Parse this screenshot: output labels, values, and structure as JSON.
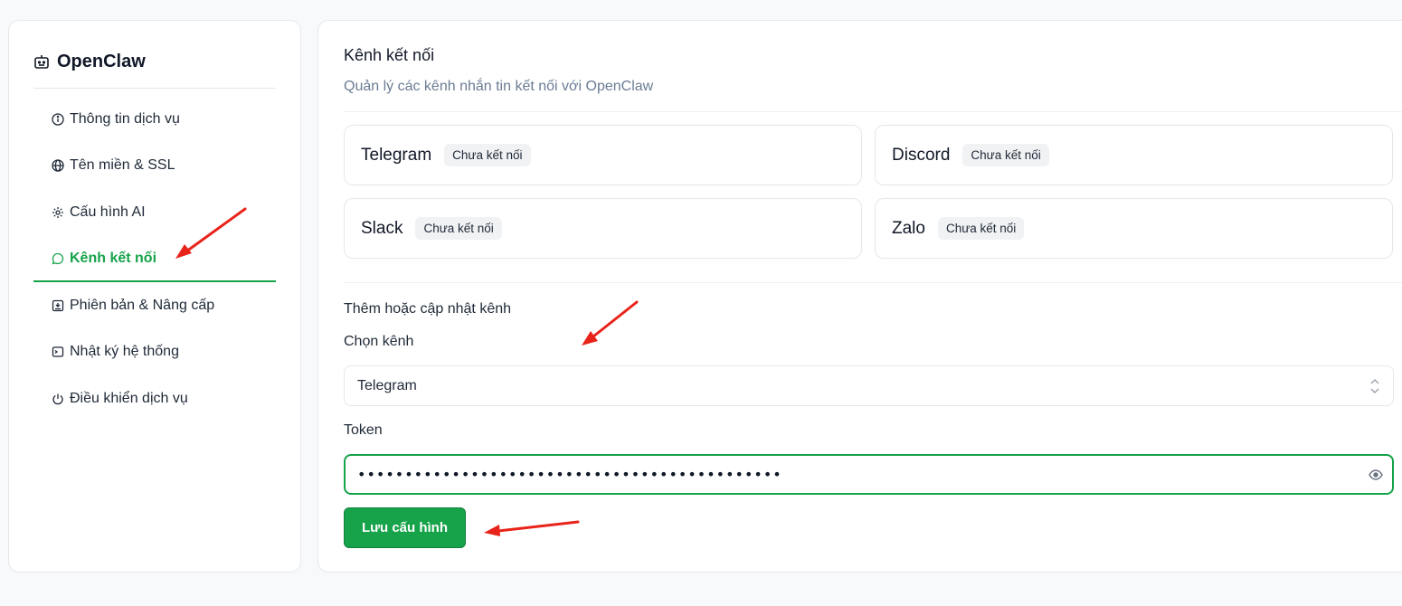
{
  "sidebar": {
    "brand": "OpenClaw",
    "items": [
      {
        "label": "Thông tin dịch vụ",
        "icon": "info-icon"
      },
      {
        "label": "Tên miền & SSL",
        "icon": "globe-icon"
      },
      {
        "label": "Cấu hình AI",
        "icon": "gear-icon"
      },
      {
        "label": "Kênh kết nối",
        "icon": "chat-icon",
        "active": true
      },
      {
        "label": "Phiên bản & Nâng cấp",
        "icon": "package-icon"
      },
      {
        "label": "Nhật ký hệ thống",
        "icon": "terminal-icon"
      },
      {
        "label": "Điều khiển dịch vụ",
        "icon": "power-icon"
      }
    ]
  },
  "main": {
    "title": "Kênh kết nối",
    "subtitle": "Quản lý các kênh nhắn tin kết nối với OpenClaw",
    "channels": [
      {
        "name": "Telegram",
        "status": "Chưa kết nối"
      },
      {
        "name": "Discord",
        "status": "Chưa kết nối"
      },
      {
        "name": "Slack",
        "status": "Chưa kết nối"
      },
      {
        "name": "Zalo",
        "status": "Chưa kết nối"
      }
    ],
    "form": {
      "section_title": "Thêm hoặc cập nhật kênh",
      "channel_label": "Chọn kênh",
      "channel_value": "Telegram",
      "token_label": "Token",
      "token_value": "•••••••••••••••••••••••••••••••••••••••••••••",
      "save_label": "Lưu cấu hình"
    }
  },
  "colors": {
    "accent": "#16a34a",
    "annotation": "#e8241a"
  }
}
